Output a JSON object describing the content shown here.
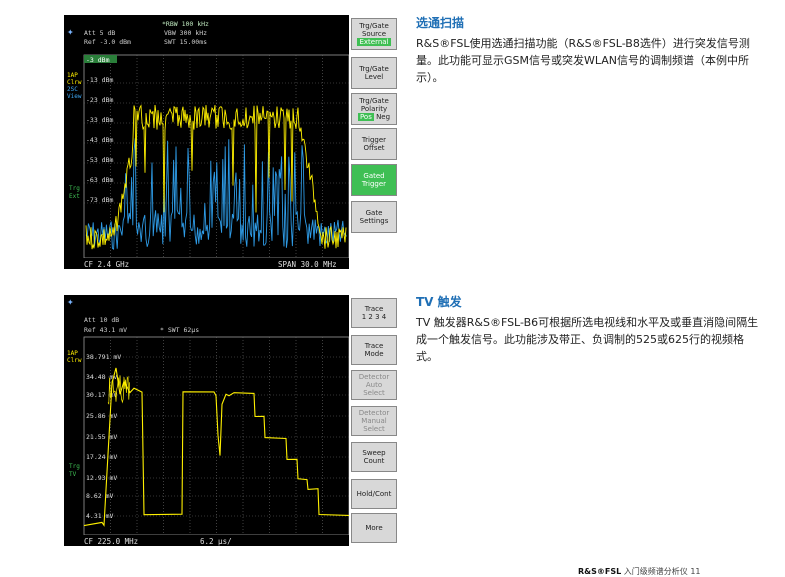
{
  "screen1": {
    "header": [
      "Att  5 dB",
      "Ref -3.0 dBm",
      "*RBW  100 kHz",
      "VBW  300 kHz",
      "SWT  15.00ms"
    ],
    "side_labels": [
      "1AP",
      "Clrw",
      "2SC",
      "View"
    ],
    "trig_labels": [
      "Trg",
      "Ext"
    ],
    "levels": [
      "-3 dBm",
      "-13 dBm",
      "-23 dBm",
      "-33 dBm",
      "-43 dBm",
      "-53 dBm",
      "-63 dBm",
      "-73 dBm"
    ],
    "footer_left": "CF 2.4 GHz",
    "footer_right": "SPAN 30.0 MHz",
    "softkeys": [
      {
        "lines": [
          "Trg/Gate",
          "Source"
        ],
        "badge": "External",
        "state": "normal"
      },
      {
        "lines": [
          "Trg/Gate",
          "Level"
        ],
        "state": "normal"
      },
      {
        "lines": [
          "Trg/Gate",
          "Polarity"
        ],
        "badge": "Pos",
        "extra": "Neg",
        "state": "normal"
      },
      {
        "lines": [
          "Trigger",
          "Offset"
        ],
        "state": "normal"
      },
      {
        "lines": [
          "Gated",
          "Trigger"
        ],
        "state": "green"
      },
      {
        "lines": [
          "Gate",
          "Settings"
        ],
        "state": "normal"
      }
    ]
  },
  "screen2": {
    "header": [
      "Att  10 dB",
      "Ref  43.1 mV",
      "* SWT 62μs"
    ],
    "side_labels": [
      "1AP",
      "Clrw"
    ],
    "trig_labels": [
      "Trg",
      "TV"
    ],
    "levels": [
      "38.791 mV",
      "34.48 mV",
      "30.17 mV",
      "25.86 mV",
      "21.55 mV",
      "17.24 mV",
      "12.93 mV",
      "8.62 mV",
      "4.31 mV"
    ],
    "footer_left": "CF 225.0 MHz",
    "footer_mid": "6.2 μs/",
    "softkeys": [
      {
        "lines": [
          "Trace"
        ],
        "extra": "1 2 3 4",
        "state": "normal"
      },
      {
        "lines": [
          "Trace",
          "Mode"
        ],
        "state": "normal"
      },
      {
        "lines": [
          "Detector",
          "Auto",
          "Select"
        ],
        "state": "disabled"
      },
      {
        "lines": [
          "Detector",
          "Manual",
          "Select"
        ],
        "state": "disabled"
      },
      {
        "lines": [
          "Sweep",
          "Count"
        ],
        "state": "normal"
      },
      {
        "lines": [
          "Hold/Cont"
        ],
        "state": "normal"
      },
      {
        "lines": [
          "More"
        ],
        "state": "normal"
      }
    ]
  },
  "section1": {
    "title": "选通扫描",
    "body": "R&S®FSL使用选通扫描功能（R&S®FSL-B8选件）进行突发信号测量。此功能可显示GSM信号或突发WLAN信号的调制频谱（本例中所示）。"
  },
  "section2": {
    "title": "TV 触发",
    "body": "TV 触发器R&S®FSL-B6可根据所选电视线和水平及或垂直消隐间隔生成一个触发信号。此功能涉及带正、负调制的525或625行的视频格式。"
  },
  "footer": {
    "bold": "R&S®FSL",
    "text": "入门级频谱分析仪   11"
  }
}
